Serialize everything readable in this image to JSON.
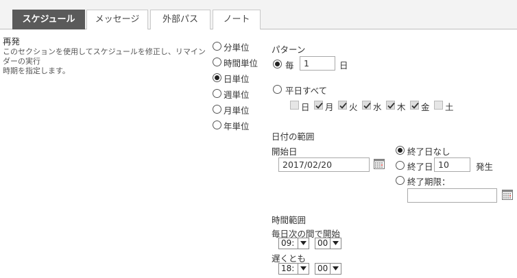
{
  "tabs": [
    {
      "label": "スケジュール"
    },
    {
      "label": "メッセージ"
    },
    {
      "label": "外部パス"
    },
    {
      "label": "ノート"
    }
  ],
  "section": {
    "title": "再発",
    "description_line1": "このセクションを使用してスケジュールを修正し、リマインダーの実行",
    "description_line2": "時期を指定します。"
  },
  "units": [
    {
      "label": "分単位",
      "selected": false
    },
    {
      "label": "時間単位",
      "selected": false
    },
    {
      "label": "日単位",
      "selected": true
    },
    {
      "label": "週単位",
      "selected": false
    },
    {
      "label": "月単位",
      "selected": false
    },
    {
      "label": "年単位",
      "selected": false
    }
  ],
  "pattern": {
    "title": "パターン",
    "every_label": "毎",
    "every_value": "1",
    "every_suffix": "日",
    "weekdays_label": "平日すべて",
    "days": [
      {
        "label": "日",
        "checked": false
      },
      {
        "label": "月",
        "checked": true
      },
      {
        "label": "火",
        "checked": true
      },
      {
        "label": "水",
        "checked": true
      },
      {
        "label": "木",
        "checked": true
      },
      {
        "label": "金",
        "checked": true
      },
      {
        "label": "土",
        "checked": false
      }
    ]
  },
  "date_range": {
    "title": "日付の範囲",
    "start_label": "開始日",
    "start_value": "2017/02/20",
    "no_end_label": "終了日なし",
    "end_after_label": "終了日",
    "end_after_value": "10",
    "occurrences_label": "発生",
    "end_by_label": "終了期限：",
    "end_by_value": ""
  },
  "time_range": {
    "title": "時間範囲",
    "start_label": "毎日次の間で開始",
    "start_hour": "09:",
    "start_minute": "00",
    "end_label": "遅くとも",
    "end_hour": "18:",
    "end_minute": "00"
  },
  "colors": {
    "active_tab_bg": "#5a5a5a",
    "tabbar_bg": "#f3f3f3"
  }
}
